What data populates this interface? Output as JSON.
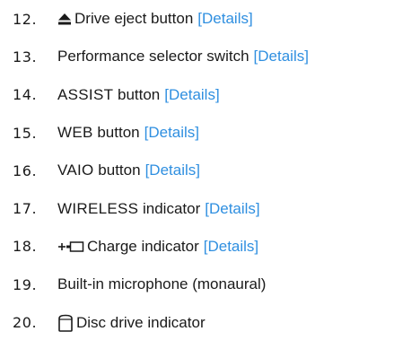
{
  "items": [
    {
      "number": "12.",
      "icon": "eject-icon",
      "label_prefix": "",
      "label": "Drive eject button",
      "link": "[Details]"
    },
    {
      "number": "13.",
      "icon": "",
      "label_prefix": "",
      "label": "Performance selector switch",
      "link": "[Details]"
    },
    {
      "number": "14.",
      "icon": "",
      "label_prefix": "ASSIST",
      "label": " button",
      "link": "[Details]"
    },
    {
      "number": "15.",
      "icon": "",
      "label_prefix": "WEB",
      "label": " button",
      "link": "[Details]"
    },
    {
      "number": "16.",
      "icon": "",
      "label_prefix": "VAIO",
      "label": " button",
      "link": "[Details]"
    },
    {
      "number": "17.",
      "icon": "",
      "label_prefix": "WIRELESS",
      "label": " indicator",
      "link": "[Details]"
    },
    {
      "number": "18.",
      "icon": "charge-icon",
      "label_prefix": "",
      "label": "Charge indicator",
      "link": "[Details]"
    },
    {
      "number": "19.",
      "icon": "",
      "label_prefix": "",
      "label": "Built-in microphone (monaural)",
      "link": ""
    },
    {
      "number": "20.",
      "icon": "disc-drive-icon",
      "label_prefix": "",
      "label": "Disc drive indicator",
      "link": ""
    }
  ],
  "colors": {
    "text": "#1a1a1a",
    "link": "#2f8fe0"
  }
}
